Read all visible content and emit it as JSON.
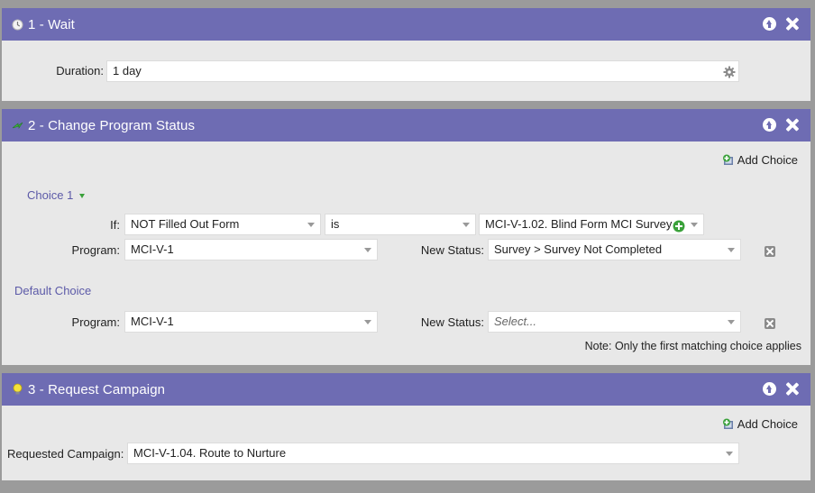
{
  "steps": [
    {
      "title": "1 - Wait",
      "icon": "clock-icon",
      "duration_label": "Duration:",
      "duration_value": "1 day"
    },
    {
      "title": "2 - Change Program Status",
      "icon": "status-change-icon",
      "add_choice_label": "Add Choice",
      "choice_label": "Choice 1",
      "if_label": "If:",
      "if_condition": "NOT Filled Out Form",
      "if_operator": "is",
      "if_value": "MCI-V-1.02. Blind Form MCI Survey",
      "program_label": "Program:",
      "program_value": "MCI-V-1",
      "new_status_label": "New Status:",
      "new_status_value": "Survey > Survey Not Completed",
      "default_choice_label": "Default Choice",
      "default_program_label": "Program:",
      "default_program_value": "MCI-V-1",
      "default_new_status_label": "New Status:",
      "default_new_status_placeholder": "Select...",
      "note": "Note: Only the first matching choice applies"
    },
    {
      "title": "3 - Request Campaign",
      "icon": "lightbulb-icon",
      "add_choice_label": "Add Choice",
      "requested_campaign_label": "Requested Campaign:",
      "requested_campaign_value": "MCI-V-1.04. Route to Nurture"
    }
  ],
  "colors": {
    "header": "#6e6cb3",
    "panel": "#e8e8e8",
    "background": "#9b9b9b",
    "link": "#5c5aa8",
    "add_icon": "#3aa13a"
  }
}
